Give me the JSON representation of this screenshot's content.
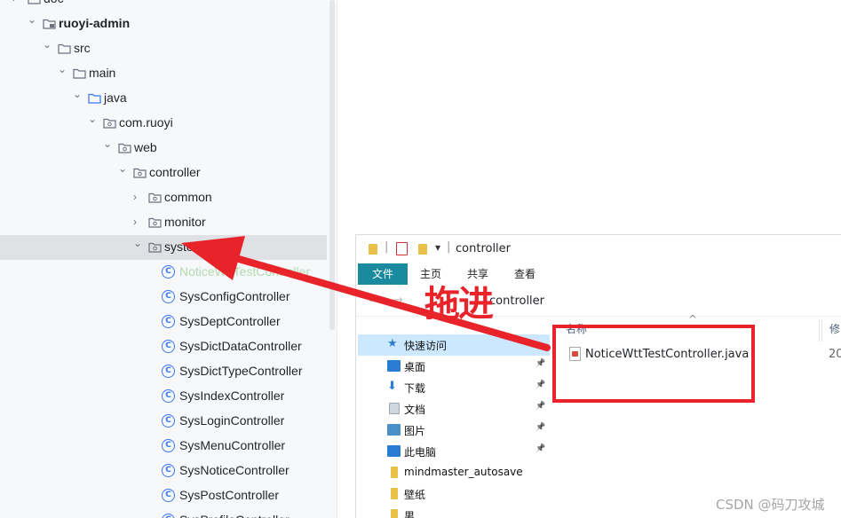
{
  "tree": {
    "items": [
      {
        "label": "doc",
        "chevron": "›"
      },
      {
        "label": "ruoyi-admin",
        "chevron": "⌄"
      },
      {
        "label": "src",
        "chevron": "⌄"
      },
      {
        "label": "main",
        "chevron": "⌄"
      },
      {
        "label": "java",
        "chevron": "⌄"
      },
      {
        "label": "com.ruoyi",
        "chevron": "⌄"
      },
      {
        "label": "web",
        "chevron": "⌄"
      },
      {
        "label": "controller",
        "chevron": "⌄"
      },
      {
        "label": "common",
        "chevron": "›"
      },
      {
        "label": "monitor",
        "chevron": "›"
      },
      {
        "label": "system",
        "chevron": "⌄"
      },
      {
        "label": "NoticeWttTestController"
      },
      {
        "label": "SysConfigController"
      },
      {
        "label": "SysDeptController"
      },
      {
        "label": "SysDictDataController"
      },
      {
        "label": "SysDictTypeController"
      },
      {
        "label": "SysIndexController"
      },
      {
        "label": "SysLoginController"
      },
      {
        "label": "SysMenuController"
      },
      {
        "label": "SysNoticeController"
      },
      {
        "label": "SysPostController"
      },
      {
        "label": "SysProfileController"
      }
    ],
    "class_icon_letter": "C"
  },
  "explorer": {
    "title": "controller",
    "title_separator": "|",
    "qat_dropdown": "▾",
    "ribbon_tabs": [
      "文件",
      "主页",
      "共享",
      "查看"
    ],
    "address": {
      "back": "←",
      "forward": "→",
      "path": "controller"
    },
    "nav": [
      {
        "label": "快速访问",
        "icon": "star-icon",
        "pinned": false
      },
      {
        "label": "桌面",
        "icon": "desktop-icon",
        "pinned": true
      },
      {
        "label": "下载",
        "icon": "download-icon",
        "pinned": true
      },
      {
        "label": "文档",
        "icon": "document-icon",
        "pinned": true
      },
      {
        "label": "图片",
        "icon": "picture-icon",
        "pinned": true
      },
      {
        "label": "此电脑",
        "icon": "computer-icon",
        "pinned": true
      },
      {
        "label": "mindmaster_autosave",
        "icon": "folder-icon",
        "pinned": false
      },
      {
        "label": "壁纸",
        "icon": "folder-icon",
        "pinned": false
      },
      {
        "label": "男",
        "icon": "folder-icon",
        "pinned": false
      }
    ],
    "pin_glyph": "📌",
    "columns": {
      "name": "名称",
      "modified": "修"
    },
    "sort_arrow": "^",
    "files": [
      {
        "name": "NoticeWttTestController.java",
        "modified": "20"
      }
    ]
  },
  "annotation": {
    "label": "拖进",
    "color": "#e8232a"
  },
  "watermark": "CSDN @码刀攻城"
}
